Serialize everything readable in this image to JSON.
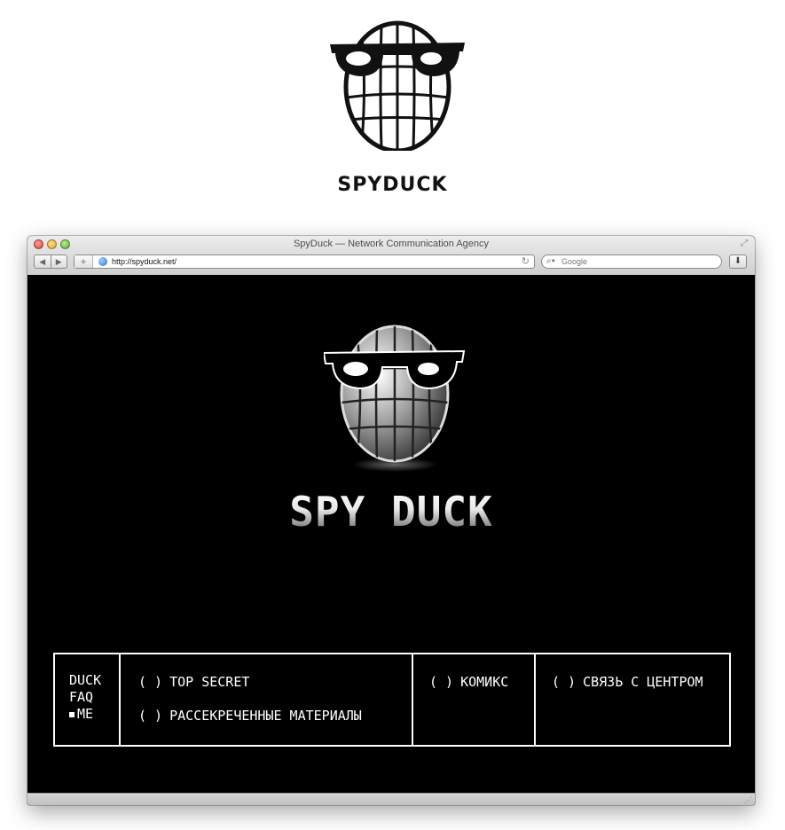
{
  "brand": {
    "wordmark": "SPYDUCK",
    "site_wordmark": "SPY DUCK"
  },
  "window": {
    "title": "SpyDuck — Network Communication Agency",
    "url": "http://spyduck.net/",
    "search_placeholder": "Google"
  },
  "menu": {
    "side": [
      {
        "label": "DUCK",
        "active": false
      },
      {
        "label": "FAQ",
        "active": false
      },
      {
        "label": "ME",
        "active": true
      }
    ],
    "bracket": "( )",
    "main": [
      "TOP SECRET",
      "РАССЕКРЕЧЕННЫЕ МАТЕРИАЛЫ"
    ],
    "comics": "КОМИКС",
    "contact": "СВЯЗЬ С ЦЕНТРОМ"
  },
  "icons": {
    "back": "back-arrow-icon",
    "forward": "forward-arrow-icon",
    "add": "plus-icon",
    "site": "globe-icon",
    "reload": "reload-icon",
    "search": "search-icon",
    "download": "download-icon"
  },
  "colors": {
    "page_bg": "#000000",
    "menu_border": "#ffffff",
    "chrome": "#d6d6d6"
  }
}
